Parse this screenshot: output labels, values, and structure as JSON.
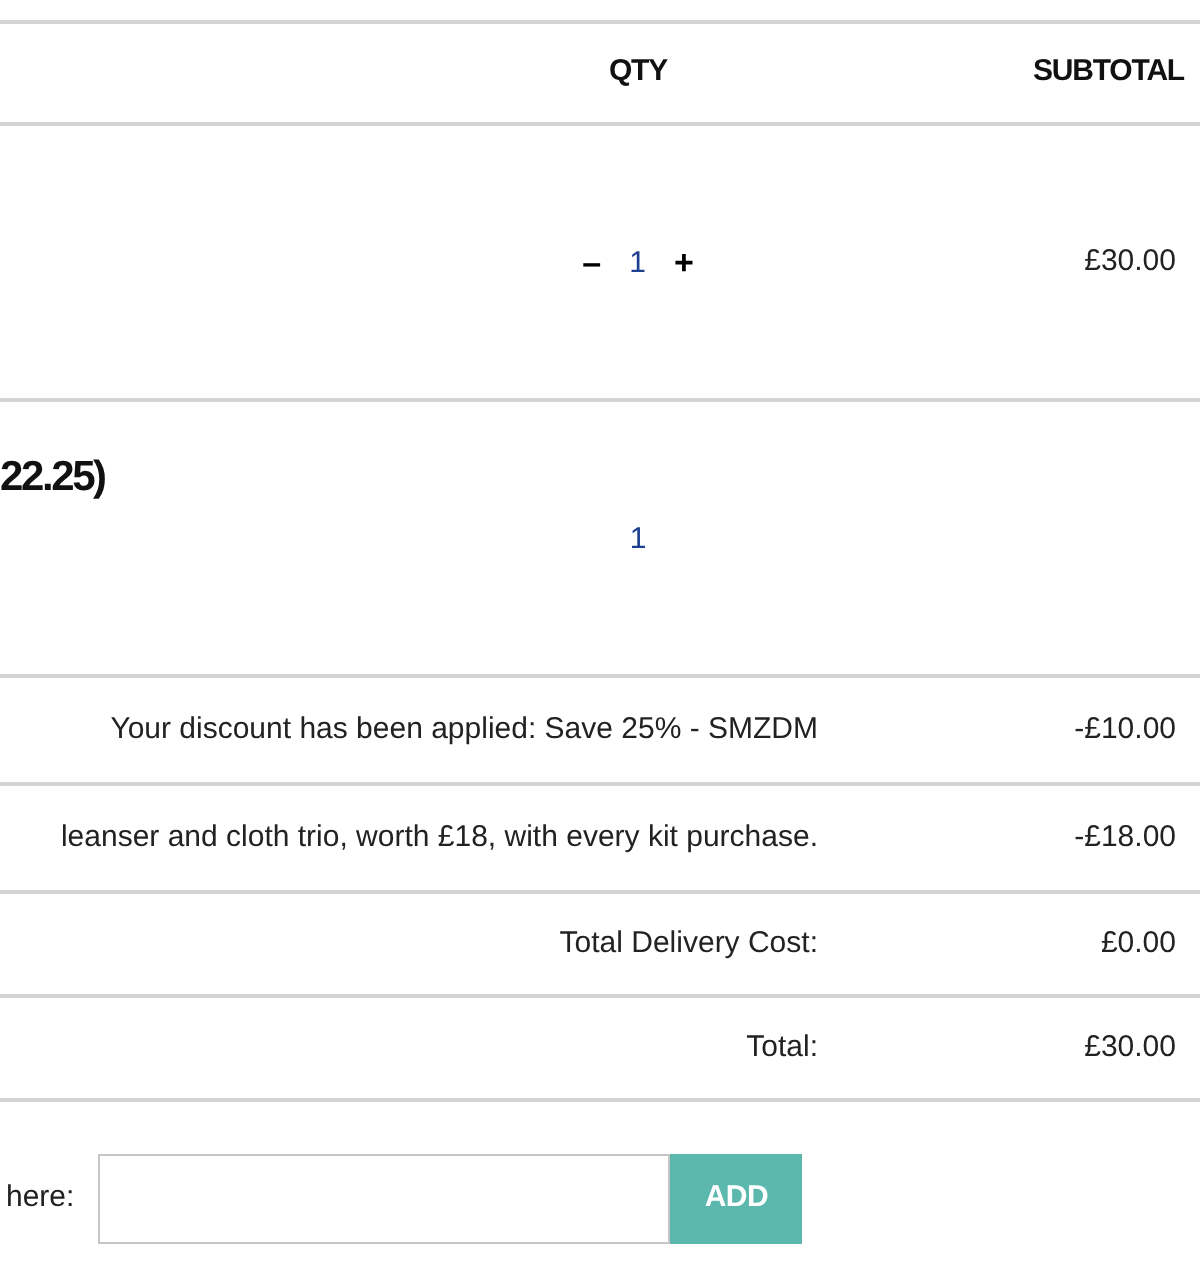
{
  "table": {
    "qty_header": "QTY",
    "subtotal_header": "SUBTOTAL"
  },
  "items": [
    {
      "qty": "1",
      "decrement": "–",
      "increment": "+",
      "subtotal": "£30.00"
    },
    {
      "title": "22.25)",
      "qty": "1"
    }
  ],
  "summary": [
    {
      "label": "Your discount has been applied: Save 25% - SMZDM",
      "amount": "-£10.00"
    },
    {
      "label": "leanser and cloth trio, worth £18, with every kit purchase.",
      "amount": "-£18.00"
    },
    {
      "label": "Total Delivery Cost:",
      "amount": "£0.00"
    },
    {
      "label": "Total:",
      "amount": "£30.00"
    }
  ],
  "promo": {
    "label": "here:",
    "button": "ADD"
  }
}
